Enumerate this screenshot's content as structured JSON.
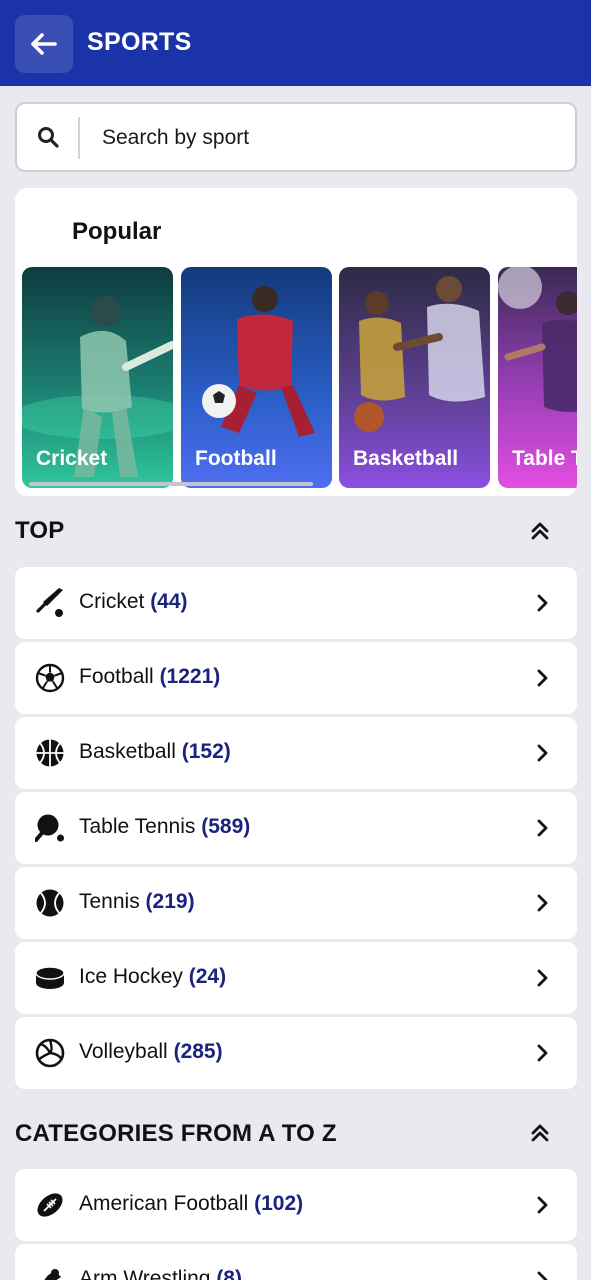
{
  "header": {
    "title": "SPORTS",
    "back_icon": "arrow-left-icon"
  },
  "search": {
    "placeholder": "Search by sport",
    "value": ""
  },
  "popular": {
    "title": "Popular",
    "tiles": [
      {
        "label": "Cricket"
      },
      {
        "label": "Football"
      },
      {
        "label": "Basketball"
      },
      {
        "label": "Table T"
      }
    ]
  },
  "top": {
    "title": "TOP",
    "items": [
      {
        "name": "Cricket",
        "count": "(44)",
        "icon": "cricket-bat-icon"
      },
      {
        "name": "Football",
        "count": "(1221)",
        "icon": "football-icon"
      },
      {
        "name": "Basketball",
        "count": "(152)",
        "icon": "basketball-icon"
      },
      {
        "name": "Table Tennis",
        "count": "(589)",
        "icon": "table-tennis-icon"
      },
      {
        "name": "Tennis",
        "count": "(219)",
        "icon": "tennis-ball-icon"
      },
      {
        "name": "Ice Hockey",
        "count": "(24)",
        "icon": "hockey-puck-icon"
      },
      {
        "name": "Volleyball",
        "count": "(285)",
        "icon": "volleyball-icon"
      }
    ]
  },
  "az": {
    "title": "CATEGORIES FROM A TO Z",
    "items": [
      {
        "name": "American Football",
        "count": "(102)",
        "icon": "american-football-icon"
      },
      {
        "name": "Arm Wrestling",
        "count": "(8)",
        "icon": "arm-wrestling-icon"
      }
    ]
  },
  "colors": {
    "header": "#1a33a8",
    "count": "#1a237e",
    "background": "#e9e9ef"
  }
}
